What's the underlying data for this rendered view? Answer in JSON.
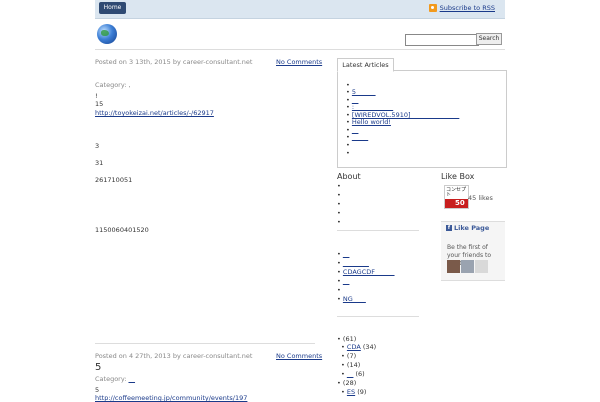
{
  "topbar": {
    "home_label": "Home",
    "rss_label": "Subscribe to RSS"
  },
  "search": {
    "button_label": "Search",
    "value": ""
  },
  "post1": {
    "meta": "Posted on 3 13th, 2015 by career-consultant.net",
    "comments": "No Comments",
    "category": "Category: ,",
    "lines": [
      "!",
      "15",
      "http://toyokeizai.net/articles/-/62917",
      "3",
      "31",
      "261710051",
      "1150060401520"
    ]
  },
  "post2": {
    "meta": "Posted on 4 27th, 2013 by career-consultant.net",
    "comments": "No Comments",
    "title": "5",
    "category_label": "Category:",
    "category_link": "__",
    "lines": [
      "5",
      "http://coffeemeeting.jp/community/events/197"
    ]
  },
  "sidebar": {
    "tab_label": "Latest Articles",
    "latest": [
      "",
      "5______",
      "__",
      ":____________",
      "[WIREDVOL.5910]_______________",
      "Hello world!",
      "__",
      "_____",
      "",
      ""
    ],
    "about_title": "About",
    "about_items": [
      "",
      "",
      "",
      "",
      ""
    ],
    "links": [
      "__",
      "________",
      "CDAGCDF______",
      "__",
      "",
      "NG____"
    ],
    "archives": [
      {
        "label": "",
        "count": "(61)",
        "indent": false
      },
      {
        "label": "CDA",
        "count": "(34)",
        "indent": true
      },
      {
        "label": "",
        "count": "(7)",
        "indent": true
      },
      {
        "label": "",
        "count": "(14)",
        "indent": true
      },
      {
        "label": "__",
        "count": "(6)",
        "indent": true
      },
      {
        "label": "",
        "count": "(28)",
        "indent": false
      },
      {
        "label": "ES",
        "count": "(9)",
        "indent": true
      }
    ],
    "likebox_title": "Like Box",
    "likebox_count": "45 likes",
    "likebox_cover_text": "コンセプト",
    "likebox_cover_number": "50",
    "fb_button": "Like Page",
    "fb_text": "Be the first of your friends to like this"
  }
}
